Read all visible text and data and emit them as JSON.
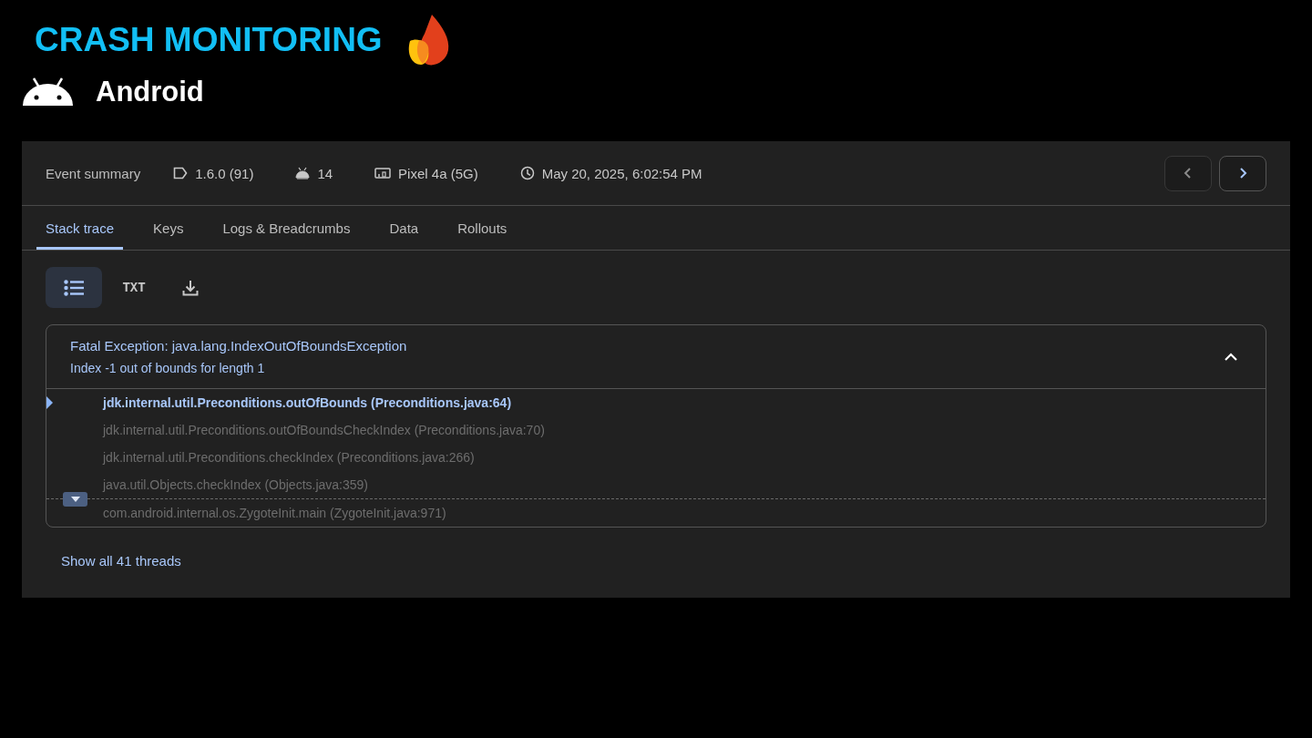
{
  "header": {
    "title": "CRASH MONITORING",
    "platform": "Android"
  },
  "summary": {
    "label": "Event summary",
    "items": [
      {
        "kind": "version",
        "text": "1.6.0 (91)"
      },
      {
        "kind": "os",
        "text": "14"
      },
      {
        "kind": "device",
        "text": "Pixel 4a (5G)"
      },
      {
        "kind": "time",
        "text": "May 20, 2025, 6:02:54 PM"
      }
    ],
    "nav": [
      {
        "kind": "prev",
        "disabled": true
      },
      {
        "kind": "next",
        "disabled": false
      }
    ]
  },
  "tabs": [
    {
      "label": "Stack trace",
      "selected": true
    },
    {
      "label": "Keys",
      "selected": false
    },
    {
      "label": "Logs & Breadcrumbs",
      "selected": false
    },
    {
      "label": "Data",
      "selected": false
    },
    {
      "label": "Rollouts",
      "selected": false
    }
  ],
  "toolbar": [
    {
      "kind": "list",
      "selected": true
    },
    {
      "kind": "txt",
      "label": "TXT",
      "selected": false
    },
    {
      "kind": "download",
      "selected": false
    }
  ],
  "exception": {
    "title": "Fatal Exception: java.lang.IndexOutOfBoundsException",
    "message": "Index -1 out of bounds for length 1",
    "expanded": true,
    "frames": [
      {
        "kind": "frame",
        "text": "jdk.internal.util.Preconditions.outOfBounds (Preconditions.java:64)",
        "highlighted": true
      },
      {
        "kind": "frame",
        "text": "jdk.internal.util.Preconditions.outOfBoundsCheckIndex (Preconditions.java:70)",
        "highlighted": false
      },
      {
        "kind": "frame",
        "text": "jdk.internal.util.Preconditions.checkIndex (Preconditions.java:266)",
        "highlighted": false
      },
      {
        "kind": "frame",
        "text": "java.util.Objects.checkIndex (Objects.java:359)",
        "highlighted": false
      },
      {
        "kind": "gap"
      },
      {
        "kind": "frame",
        "text": "com.android.internal.os.ZygoteInit.main (ZygoteInit.java:971)",
        "highlighted": false
      }
    ]
  },
  "threads_link": "Show all 41 threads"
}
